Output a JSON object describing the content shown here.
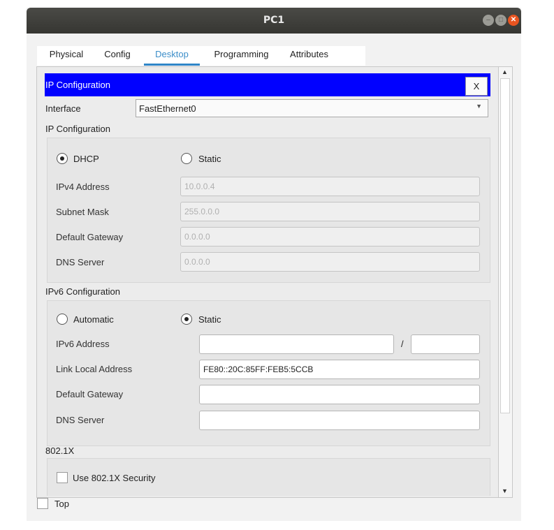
{
  "window": {
    "title": "PC1"
  },
  "tabs": [
    {
      "label": "Physical"
    },
    {
      "label": "Config"
    },
    {
      "label": "Desktop"
    },
    {
      "label": "Programming"
    },
    {
      "label": "Attributes"
    }
  ],
  "ip_config_panel": {
    "title": "IP Configuration",
    "close_label": "X"
  },
  "interface": {
    "label": "Interface",
    "value": "FastEthernet0"
  },
  "ipv4": {
    "section_label": "IP Configuration",
    "dhcp_label": "DHCP",
    "static_label": "Static",
    "selected": "DHCP",
    "fields": {
      "ipv4_address": {
        "label": "IPv4 Address",
        "value": "10.0.0.4"
      },
      "subnet_mask": {
        "label": "Subnet Mask",
        "value": "255.0.0.0"
      },
      "default_gateway": {
        "label": "Default Gateway",
        "value": "0.0.0.0"
      },
      "dns_server": {
        "label": "DNS Server",
        "value": "0.0.0.0"
      }
    }
  },
  "ipv6": {
    "section_label": "IPv6 Configuration",
    "automatic_label": "Automatic",
    "static_label": "Static",
    "selected": "Static",
    "fields": {
      "ipv6_address": {
        "label": "IPv6 Address",
        "value": "",
        "slash": "/",
        "prefix": ""
      },
      "link_local": {
        "label": "Link Local Address",
        "value": "FE80::20C:85FF:FEB5:5CCB"
      },
      "default_gateway": {
        "label": "Default Gateway",
        "value": ""
      },
      "dns_server": {
        "label": "DNS Server",
        "value": ""
      }
    }
  },
  "dot1x": {
    "section_label": "802.1X",
    "use_security_label": "Use 802.1X Security"
  },
  "footer": {
    "top_label": "Top"
  },
  "colors": {
    "ip_bar": "#0101ff",
    "active_tab": "#2f86c8",
    "close_button": "#e95420"
  }
}
